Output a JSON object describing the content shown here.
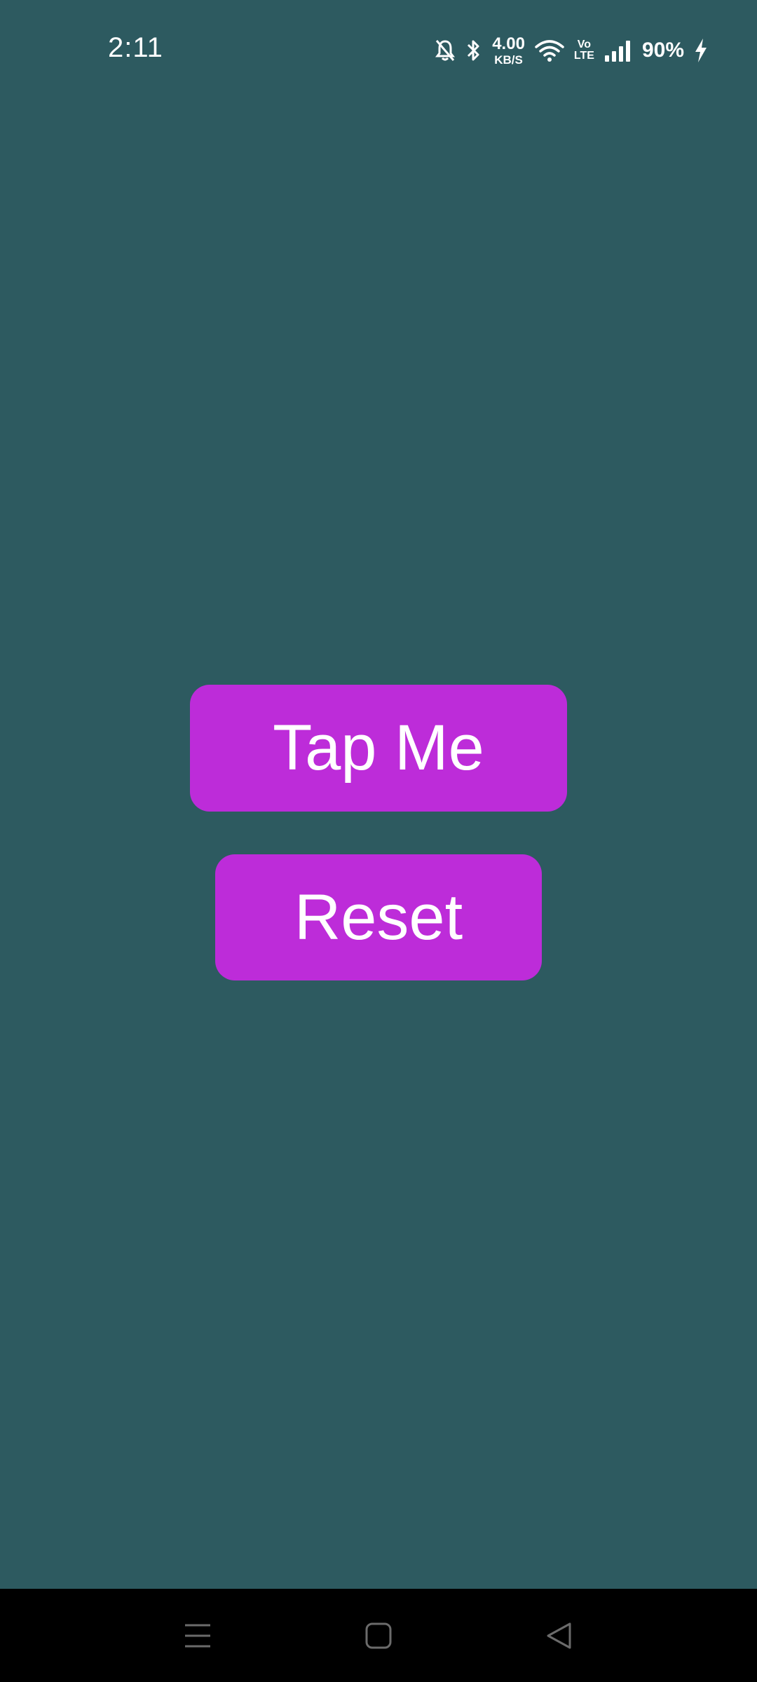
{
  "status_bar": {
    "time": "2:11",
    "net_speed_value": "4.00",
    "net_speed_unit": "KB/S",
    "volte_top": "Vo",
    "volte_bottom": "LTE",
    "battery": "90%"
  },
  "buttons": {
    "tap_label": "Tap Me",
    "reset_label": "Reset"
  },
  "colors": {
    "background": "#2d5a60",
    "button": "#bd2cd9",
    "nav_bar": "#000000"
  },
  "icons": {
    "status": [
      "bell-off-icon",
      "bluetooth-icon",
      "wifi-icon",
      "signal-icon",
      "charging-icon"
    ],
    "nav": [
      "menu-icon",
      "home-icon",
      "back-icon"
    ]
  }
}
